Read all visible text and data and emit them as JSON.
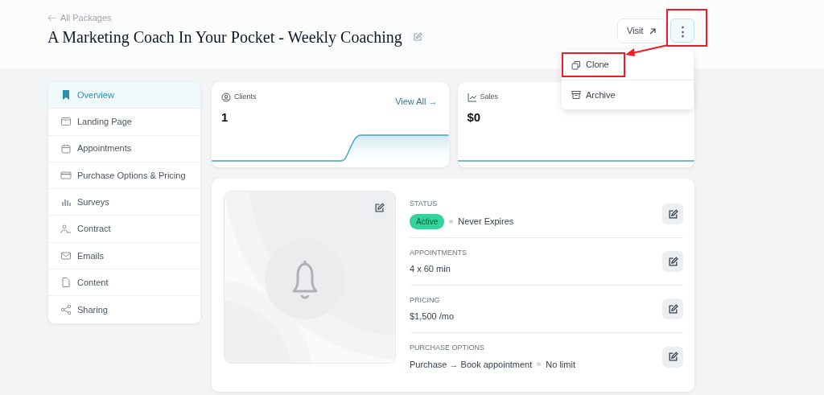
{
  "header": {
    "back_link": "All Packages",
    "title": "A Marketing Coach In Your Pocket - Weekly Coaching",
    "visit_button": "Visit",
    "more_button": "⋮"
  },
  "menu": {
    "items": [
      {
        "label": "Clone",
        "highlighted": true
      },
      {
        "label": "Archive",
        "highlighted": false
      }
    ]
  },
  "sidebar": {
    "items": [
      {
        "label": "Overview",
        "selected": true
      },
      {
        "label": "Landing Page",
        "selected": false
      },
      {
        "label": "Appointments",
        "selected": false
      },
      {
        "label": "Purchase Options & Pricing",
        "selected": false
      },
      {
        "label": "Surveys",
        "selected": false
      },
      {
        "label": "Contract",
        "selected": false
      },
      {
        "label": "Emails",
        "selected": false
      },
      {
        "label": "Content",
        "selected": false
      },
      {
        "label": "Sharing",
        "selected": false
      }
    ]
  },
  "stats": [
    {
      "label": "Clients",
      "value": "1",
      "link": "View All →"
    },
    {
      "label": "Sales",
      "value": "$0"
    }
  ],
  "details": [
    {
      "label": "STATUS",
      "badge": "Active",
      "values": [
        "Never Expires"
      ]
    },
    {
      "label": "APPOINTMENTS",
      "values": [
        "4 x 60 min"
      ]
    },
    {
      "label": "PRICING",
      "values": [
        "$1,500 /mo"
      ]
    },
    {
      "label": "PURCHASE OPTIONS",
      "values": [
        "Purchase → Book appointment",
        "No limit"
      ]
    }
  ]
}
